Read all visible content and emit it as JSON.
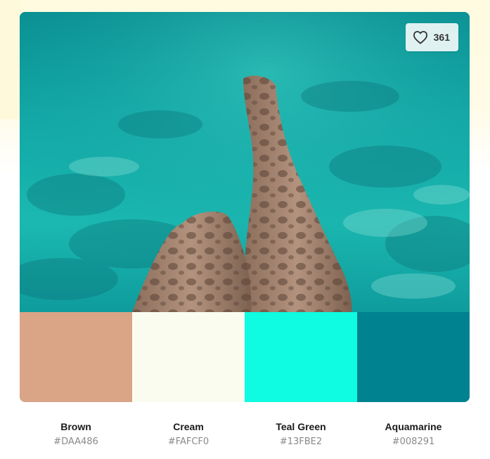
{
  "photo": {
    "alt_icon": "underwater-legs-photo",
    "water_colors": [
      "#0fa6a4",
      "#1db8b2",
      "#0e7f84",
      "#5fd3c7"
    ],
    "skin_color": "#a2836f"
  },
  "like": {
    "icon": "heart-icon",
    "count": "361"
  },
  "palette": [
    {
      "name": "Brown",
      "hex": "#DAA486",
      "color": "#DAA486"
    },
    {
      "name": "Cream",
      "hex": "#FAFCF0",
      "color": "#FAFCF0"
    },
    {
      "name": "Teal Green",
      "hex": "#13FBE2",
      "color": "#0FFBE2"
    },
    {
      "name": "Aquamarine",
      "hex": "#008291",
      "color": "#008291"
    }
  ]
}
